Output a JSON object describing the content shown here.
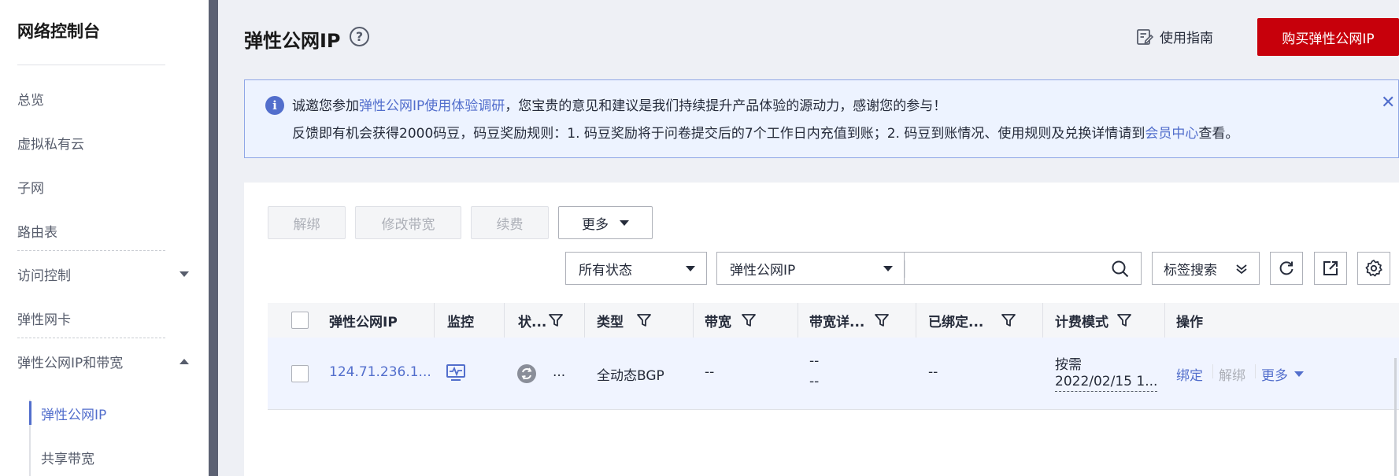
{
  "sidebar": {
    "title": "网络控制台",
    "items": [
      {
        "label": "总览"
      },
      {
        "label": "虚拟私有云"
      },
      {
        "label": "子网"
      },
      {
        "label": "路由表"
      },
      {
        "label": "访问控制"
      },
      {
        "label": "弹性网卡"
      },
      {
        "label": "弹性公网IP和带宽"
      }
    ],
    "sub_items": [
      {
        "label": "弹性公网IP"
      },
      {
        "label": "共享带宽"
      }
    ]
  },
  "header": {
    "title": "弹性公网IP",
    "help_icon": "?",
    "guide_label": "使用指南",
    "buy_label": "购买弹性公网IP"
  },
  "notice": {
    "line1_prefix": "诚邀您参加",
    "line1_link": "弹性公网IP使用体验调研",
    "line1_suffix": "，您宝贵的意见和建议是我们持续提升产品体验的源动力，感谢您的参与！",
    "line2_prefix": "反馈即有机会获得2000码豆，码豆奖励规则：1. 码豆奖励将于问卷提交后的7个工作日内充值到账；2. 码豆到账情况、使用规则及兑换详情请到",
    "line2_link": "会员中心",
    "line2_suffix": "查看。",
    "info_icon": "i",
    "close_icon": "✕"
  },
  "toolbar": {
    "unbind": "解绑",
    "modify_bw": "修改带宽",
    "renew": "续费",
    "more": "更多"
  },
  "filters": {
    "status_select": "所有状态",
    "type_select": "弹性公网IP",
    "search_value": "",
    "tag_search": "标签搜索"
  },
  "table": {
    "headers": {
      "ip": "弹性公网IP",
      "monitor": "监控",
      "status": "状...",
      "type": "类型",
      "bandwidth": "带宽",
      "bw_detail": "带宽详...",
      "bound": "已绑定...",
      "billing": "计费模式",
      "ops": "操作"
    },
    "row": {
      "ip": "124.71.236.1...",
      "status_text": "...",
      "type": "全动态BGP",
      "bandwidth": "--",
      "bw_detail_1": "--",
      "bw_detail_2": "--",
      "bound": "--",
      "billing_mode": "按需",
      "billing_date": "2022/02/15 1...",
      "op_bind": "绑定",
      "op_unbind": "解绑",
      "op_more": "更多"
    }
  },
  "colors": {
    "accent": "#526ecc",
    "brand_red": "#c7000b"
  }
}
